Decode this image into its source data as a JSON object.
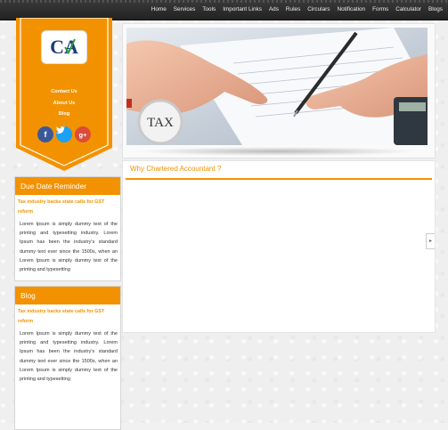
{
  "nav": {
    "items": [
      "Home",
      "Services",
      "Tools",
      "Important Links",
      "Ads",
      "Rules",
      "Circulars",
      "Notification",
      "Forms",
      "Calculator",
      "Blogs"
    ]
  },
  "banner": {
    "logo_text": "CA",
    "links": [
      "Contact Us",
      "About Us",
      "Blog"
    ],
    "social": [
      {
        "icon": "facebook-icon",
        "glyph": "f",
        "color": "#3b5998"
      },
      {
        "icon": "twitter-icon",
        "glyph": "t",
        "color": "#1da1f2"
      },
      {
        "icon": "google-plus-icon",
        "glyph": "g+",
        "color": "#dd4b39"
      }
    ]
  },
  "hero": {
    "tax_label": "TAX"
  },
  "why": {
    "title": "Why Chartered Accountant ?"
  },
  "scroll_tab": "▸",
  "due_date": {
    "heading": "Due Date Reminder",
    "link": "Tax industry backs state calls for GST reform",
    "text": "Lorem Ipsum is simply dummy text of the printing and typesetting industry. Lorem Ipsum has been the industry's standard dummy text ever since the 1500s, when an Lorem Ipsum is simply dummy text of the printing and typesetting"
  },
  "blog": {
    "heading": "Blog",
    "link": "Tax industry backs state calls for GST reform",
    "text": "Lorem Ipsum is simply dummy text of the printing and typesetting industry. Lorem Ipsum has been the industry's standard dummy text ever since the 1500s, when an Lorem Ipsum is simply dummy text of the printing and typesetting"
  },
  "colors": {
    "accent": "#f39200",
    "nav_bg": "#2b2b2b"
  }
}
